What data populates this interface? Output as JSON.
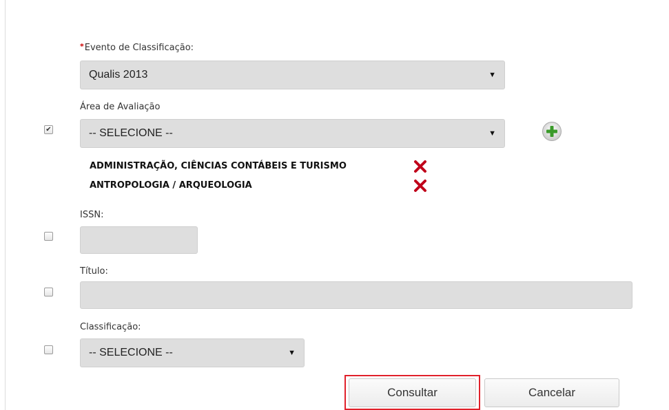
{
  "form": {
    "evento": {
      "required_mark": "*",
      "label": "Evento de Classificação:",
      "value": "Qualis 2013"
    },
    "area": {
      "checked": true,
      "label": "Área de Avaliação",
      "value": "-- SELECIONE --",
      "add_icon": "plus-circle-icon",
      "selected_items": [
        {
          "name": "ADMINISTRAÇÃO, CIÊNCIAS CONTÁBEIS E TURISMO",
          "remove_icon": "remove-x-icon"
        },
        {
          "name": "ANTROPOLOGIA / ARQUEOLOGIA",
          "remove_icon": "remove-x-icon"
        }
      ]
    },
    "issn": {
      "checked": false,
      "label": "ISSN:",
      "value": ""
    },
    "titulo": {
      "checked": false,
      "label": "Título:",
      "value": ""
    },
    "classificacao": {
      "checked": false,
      "label": "Classificação:",
      "value": "-- SELECIONE --"
    }
  },
  "actions": {
    "consultar_label": "Consultar",
    "cancelar_label": "Cancelar",
    "highlight_color": "#e0202a"
  },
  "colors": {
    "field_background": "#dedede",
    "remove_icon": "#c0001a",
    "add_icon": "#3a9a2a"
  }
}
